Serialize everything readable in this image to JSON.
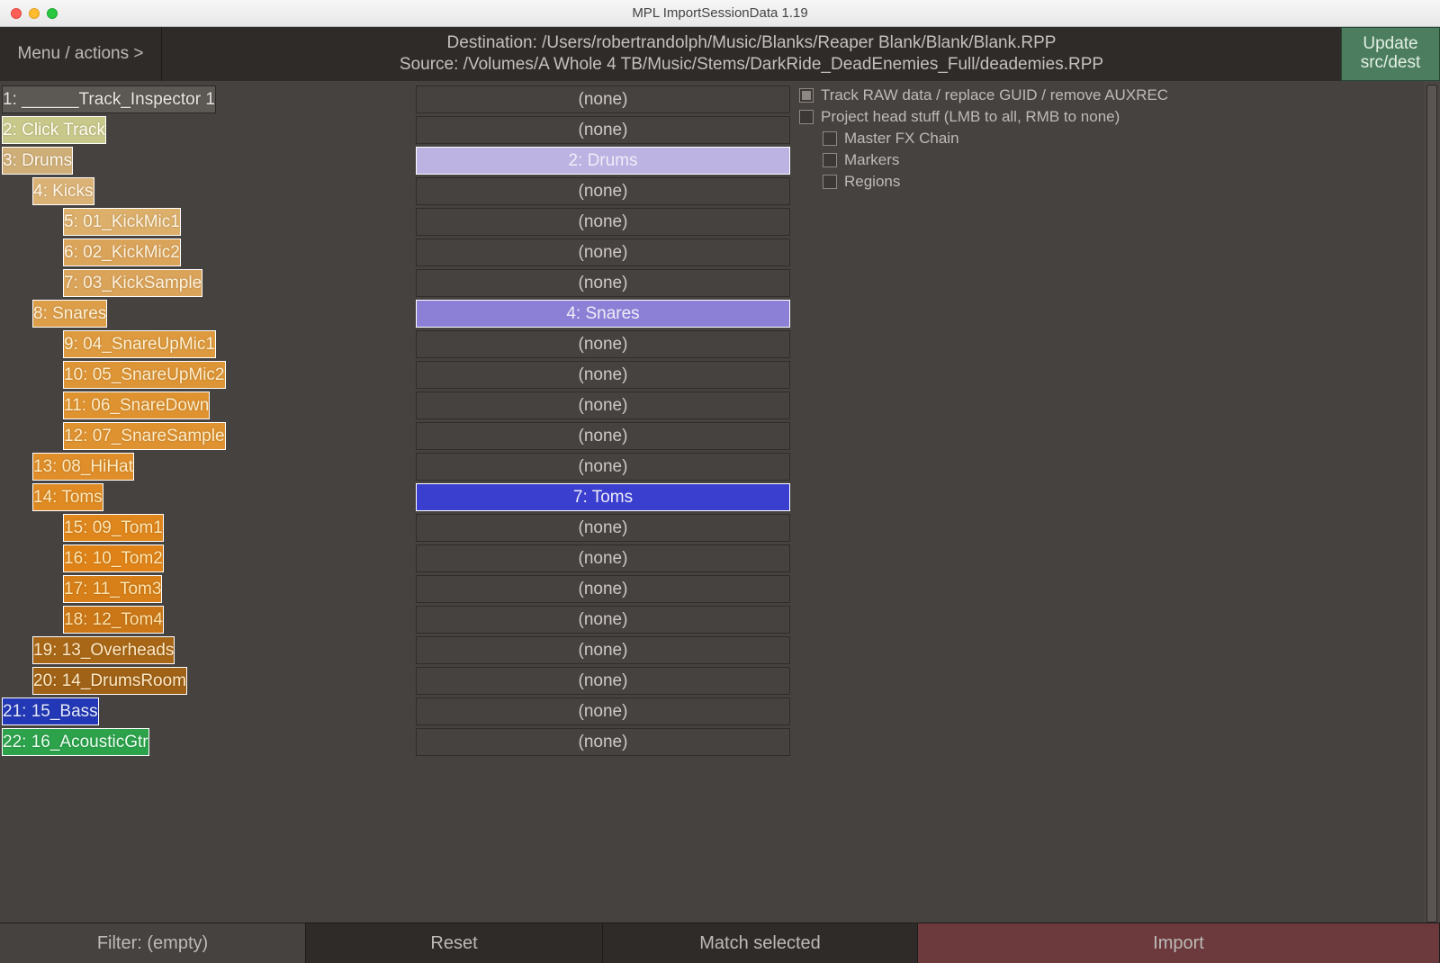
{
  "window": {
    "title": "MPL ImportSessionData 1.19"
  },
  "header": {
    "menu_label": "Menu / actions >",
    "dest_line": "Destination: /Users/robertrandolph/Music/Blanks/Reaper Blank/Blank/Blank.RPP",
    "src_line": "Source: /Volumes/A Whole 4 TB/Music/Stems/DarkRide_DeadEnemies_Full/deademies.RPP",
    "update_line1": "Update",
    "update_line2": "src/dest"
  },
  "tracks": [
    {
      "indent": 0,
      "label": "1: ______Track_Inspector 1",
      "color": "#5c5955",
      "tcolor": "#e9e5e1",
      "dst": "(none)",
      "flash": false
    },
    {
      "indent": 0,
      "label": "2: Click Track",
      "color": "#c9c88b",
      "tcolor": "#fffef0",
      "dst": "(none)",
      "flash": true
    },
    {
      "indent": 0,
      "label": "3: Drums",
      "color": "#cfae77",
      "tcolor": "#fff7ea",
      "dst": "2: Drums",
      "dcolor": "#bdb3e2",
      "flash": true
    },
    {
      "indent": 1,
      "label": "4: Kicks",
      "color": "#dbb275",
      "tcolor": "#fff6e6",
      "dst": "(none)",
      "flash": true
    },
    {
      "indent": 2,
      "label": "5: 01_KickMic1",
      "color": "#dcaf6b",
      "tcolor": "#fff4e0",
      "dst": "(none)",
      "flash": true
    },
    {
      "indent": 2,
      "label": "6: 02_KickMic2",
      "color": "#dba45b",
      "tcolor": "#fff2db",
      "dst": "(none)",
      "flash": true
    },
    {
      "indent": 2,
      "label": "7: 03_KickSample",
      "color": "#dba45b",
      "tcolor": "#fff2db",
      "dst": "(none)",
      "flash": true
    },
    {
      "indent": 1,
      "label": "8: Snares",
      "color": "#dd9e49",
      "tcolor": "#fff0d4",
      "dst": "4: Snares",
      "dcolor": "#8b80d6",
      "flash": true
    },
    {
      "indent": 2,
      "label": "9: 04_SnareUpMic1",
      "color": "#de9a3e",
      "tcolor": "#ffefce",
      "dst": "(none)",
      "flash": true
    },
    {
      "indent": 2,
      "label": "10: 05_SnareUpMic2",
      "color": "#de9536",
      "tcolor": "#ffedc9",
      "dst": "(none)",
      "flash": true
    },
    {
      "indent": 2,
      "label": "11: 06_SnareDown",
      "color": "#df9230",
      "tcolor": "#ffecc5",
      "dst": "(none)",
      "flash": true
    },
    {
      "indent": 2,
      "label": "12: 07_SnareSample",
      "color": "#df9230",
      "tcolor": "#ffecc5",
      "dst": "(none)",
      "flash": true
    },
    {
      "indent": 1,
      "label": "13: 08_HiHat",
      "color": "#df8e2a",
      "tcolor": "#ffeabf",
      "dst": "(none)",
      "flash": true
    },
    {
      "indent": 1,
      "label": "14: Toms",
      "color": "#df8a22",
      "tcolor": "#ffe8b9",
      "dst": "7: Toms",
      "dcolor": "#3a3fd0",
      "flash": true
    },
    {
      "indent": 2,
      "label": "15: 09_Tom1",
      "color": "#df861c",
      "tcolor": "#ffe6b3",
      "dst": "(none)",
      "flash": true
    },
    {
      "indent": 2,
      "label": "16: 10_Tom2",
      "color": "#df8318",
      "tcolor": "#ffe5af",
      "dst": "(none)",
      "flash": true
    },
    {
      "indent": 2,
      "label": "17: 11_Tom3",
      "color": "#d77f18",
      "tcolor": "#ffe3ab",
      "dst": "(none)",
      "flash": true
    },
    {
      "indent": 2,
      "label": "18: 12_Tom4",
      "color": "#cb7717",
      "tcolor": "#ffe1a6",
      "dst": "(none)",
      "flash": true
    },
    {
      "indent": 1,
      "label": "19: 13_Overheads",
      "color": "#a86717",
      "tcolor": "#ffe9c4",
      "dst": "(none)",
      "flash": true
    },
    {
      "indent": 1,
      "label": "20: 14_DrumsRoom",
      "color": "#a06217",
      "tcolor": "#ffe9c4",
      "dst": "(none)",
      "flash": true
    },
    {
      "indent": 0,
      "label": "21: 15_Bass",
      "color": "#2238b6",
      "tcolor": "#e5e9ff",
      "dst": "(none)",
      "flash": true
    },
    {
      "indent": 0,
      "label": "22: 16_AcousticGtr",
      "color": "#2ca24b",
      "tcolor": "#eafff0",
      "dst": "(none)",
      "flash": true
    }
  ],
  "options": {
    "raw": {
      "checked": true,
      "label": "Track RAW data / replace GUID / remove AUXREC"
    },
    "head": {
      "checked": false,
      "label": "Project head stuff (LMB to all, RMB to none)"
    },
    "fx": {
      "checked": false,
      "label": "Master FX Chain"
    },
    "mk": {
      "checked": false,
      "label": "Markers"
    },
    "rg": {
      "checked": false,
      "label": "Regions"
    }
  },
  "footer": {
    "filter": "Filter: (empty)",
    "reset": "Reset",
    "match": "Match selected",
    "import": "Import"
  }
}
